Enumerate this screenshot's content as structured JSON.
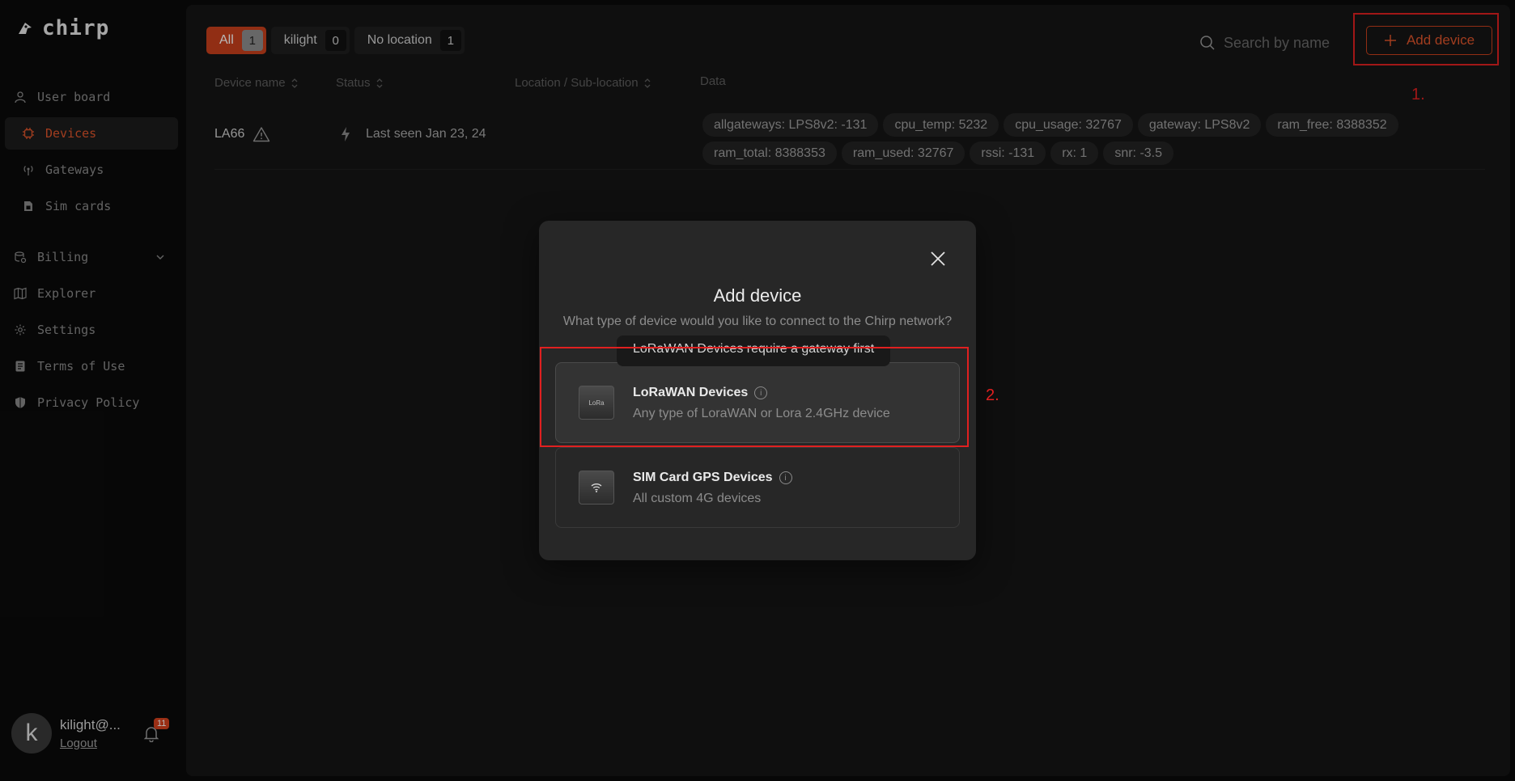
{
  "brand": {
    "name": "chirp"
  },
  "sidebar": {
    "items": [
      {
        "label": "User board",
        "icon": "user-icon",
        "active": false
      },
      {
        "label": "Devices",
        "icon": "chip-icon",
        "active": true
      },
      {
        "label": "Gateways",
        "icon": "antenna-icon",
        "active": false
      },
      {
        "label": "Sim cards",
        "icon": "sim-card-icon",
        "active": false
      },
      {
        "label": "Billing",
        "icon": "billing-icon",
        "active": false
      },
      {
        "label": "Explorer",
        "icon": "map-icon",
        "active": false
      },
      {
        "label": "Settings",
        "icon": "gear-icon",
        "active": false
      },
      {
        "label": "Terms of Use",
        "icon": "document-icon",
        "active": false
      },
      {
        "label": "Privacy Policy",
        "icon": "shield-icon",
        "active": false
      }
    ]
  },
  "user": {
    "initial": "k",
    "name": "kilight@...",
    "logout": "Logout",
    "notifications": "11"
  },
  "filters": [
    {
      "label": "All",
      "count": "1",
      "active": true
    },
    {
      "label": "kilight",
      "count": "0",
      "active": false
    },
    {
      "label": "No location",
      "count": "1",
      "active": false
    }
  ],
  "search": {
    "placeholder": "Search by name"
  },
  "add_device": {
    "label": "Add device"
  },
  "annotations": {
    "step1": "1.",
    "step2": "2."
  },
  "table": {
    "headers": [
      "Device name",
      "Status",
      "Location / Sub-location",
      "Data"
    ],
    "rows": [
      {
        "name": "LA66",
        "status": "Last seen Jan 23, 24",
        "tags": [
          "allgateways: LPS8v2: -131",
          "cpu_temp: 5232",
          "cpu_usage: 32767",
          "gateway: LPS8v2",
          "ram_free: 8388352",
          "ram_total: 8388353",
          "ram_used: 32767",
          "rssi: -131",
          "rx: 1",
          "snr: -3.5"
        ]
      }
    ]
  },
  "modal": {
    "title": "Add device",
    "subtitle": "What type of device would you like to connect to the Chirp network?",
    "tooltip": "LoRaWAN Devices require a gateway first",
    "options": [
      {
        "title": "LoRaWAN Devices",
        "desc": "Any type of LoraWAN or Lora 2.4GHz device",
        "icon": "lorawan-device-icon",
        "icon_text": "LoRa"
      },
      {
        "title": "SIM Card GPS Devices",
        "desc": "All custom 4G devices",
        "icon": "wifi-device-icon"
      }
    ]
  },
  "colors": {
    "accent": "#c9401c",
    "annotation_red": "#e02020",
    "background": "#0b0b0b",
    "panel": "#151515",
    "modal": "#272727"
  }
}
